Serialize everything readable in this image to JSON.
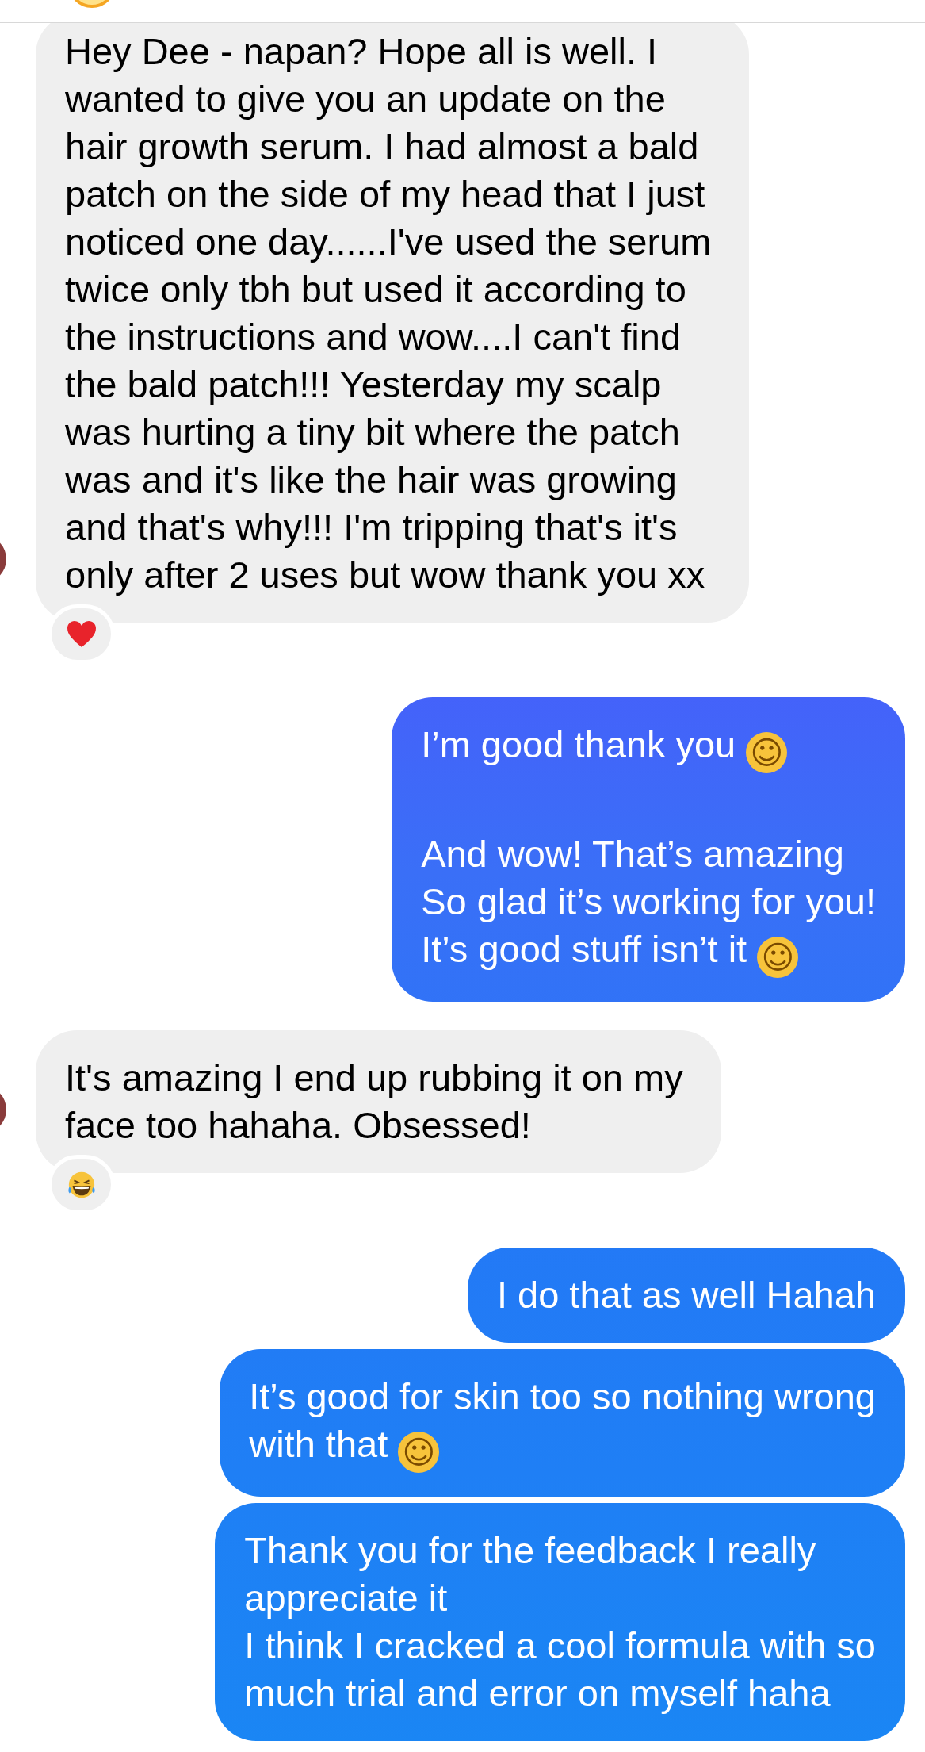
{
  "messages": [
    {
      "kind": "received",
      "avatar": true,
      "paragraphs": [
        [
          {
            "text": "Hey Dee - napan? Hope all is well. I"
          },
          {
            "text": "wanted to give you an update on the"
          },
          {
            "text": "hair growth serum. I had almost a bald"
          },
          {
            "text": "patch on the side of my head that I just"
          },
          {
            "text": "noticed one day......I've used the serum"
          },
          {
            "text": "twice only tbh but used it according to"
          },
          {
            "text": "the instructions and wow....I can't find"
          },
          {
            "text": "the bald patch!!! Yesterday my scalp"
          },
          {
            "text": "was hurting a tiny bit where the patch"
          },
          {
            "text": "was and it's like the hair was growing"
          },
          {
            "text": "and that's why!!! I'm tripping that's it's"
          },
          {
            "text": "only after 2 uses but wow thank you xx"
          }
        ]
      ],
      "reaction": {
        "kind": "heart"
      }
    },
    {
      "kind": "sent",
      "paragraphs": [
        [
          {
            "text": "I’m good thank you",
            "emoji": "☺"
          }
        ],
        [
          {
            "text": "And wow! That’s amazing"
          },
          {
            "text": "So glad it’s working for you!"
          },
          {
            "text": "It’s good stuff isn’t it",
            "emoji": "☺"
          }
        ]
      ]
    },
    {
      "kind": "received",
      "avatar": true,
      "paragraphs": [
        [
          {
            "text": "It's amazing I end up rubbing it on my"
          },
          {
            "text": "face too hahaha. Obsessed!"
          }
        ]
      ],
      "reaction": {
        "kind": "laugh"
      }
    },
    {
      "kind": "sent",
      "paragraphs": [
        [
          {
            "text": "I do that as well Hahah"
          }
        ]
      ]
    },
    {
      "kind": "sent",
      "paragraphs": [
        [
          {
            "text": "It’s good for skin too so nothing wrong"
          },
          {
            "text": "with that",
            "emoji": "☺"
          }
        ]
      ]
    },
    {
      "kind": "sent",
      "paragraphs": [
        [
          {
            "text": "Thank you for the feedback I really"
          },
          {
            "text": "appreciate it"
          },
          {
            "text": "I think I cracked a cool formula with so"
          },
          {
            "text": "much trial and error on myself haha"
          }
        ]
      ]
    }
  ]
}
